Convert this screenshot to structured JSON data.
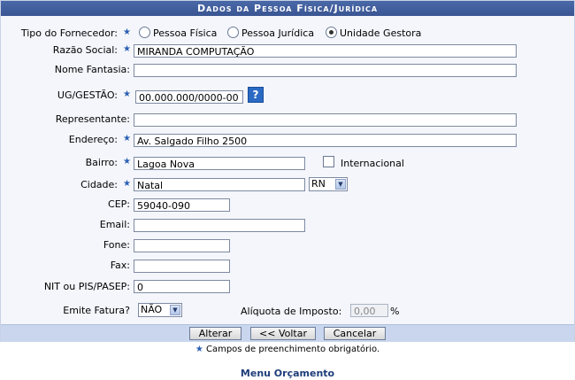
{
  "header": {
    "title": "Dados da Pessoa Física/Jurídica"
  },
  "tipo": {
    "label": "Tipo do Fornecedor:",
    "options": [
      "Pessoa Física",
      "Pessoa Jurídica",
      "Unidade Gestora"
    ],
    "selected": "Unidade Gestora"
  },
  "fields": {
    "razao_social": {
      "label": "Razão Social:",
      "value": "MIRANDA COMPUTAÇÃO"
    },
    "nome_fantasia": {
      "label": "Nome Fantasia:",
      "value": ""
    },
    "ug_gestao": {
      "label": "UG/GESTÃO:",
      "value": "00.000.000/0000-00"
    },
    "representante": {
      "label": "Representante:",
      "value": ""
    },
    "endereco": {
      "label": "Endereço:",
      "value": "Av. Salgado Filho 2500"
    },
    "bairro": {
      "label": "Bairro:",
      "value": "Lagoa Nova"
    },
    "internacional": {
      "label": "Internacional",
      "checked": false
    },
    "cidade": {
      "label": "Cidade:",
      "value": "Natal"
    },
    "uf": {
      "value": "RN"
    },
    "cep": {
      "label": "CEP:",
      "value": "59040-090"
    },
    "email": {
      "label": "Email:",
      "value": ""
    },
    "fone": {
      "label": "Fone:",
      "value": ""
    },
    "fax": {
      "label": "Fax:",
      "value": ""
    },
    "nit": {
      "label": "NIT ou PIS/PASEP:",
      "value": "0"
    },
    "emite_fatura": {
      "label": "Emite Fatura?",
      "value": "NÃO"
    },
    "aliquota": {
      "label": "Alíquota de Imposto:",
      "value": "0,00",
      "unit": "%"
    }
  },
  "help_icon": {
    "glyph": "?"
  },
  "buttons": {
    "alterar": "Alterar",
    "voltar": "<< Voltar",
    "cancelar": "Cancelar"
  },
  "required_glyph": "★",
  "required_note": "Campos de preenchimento obrigatório.",
  "menu_link": "Menu Orçamento"
}
